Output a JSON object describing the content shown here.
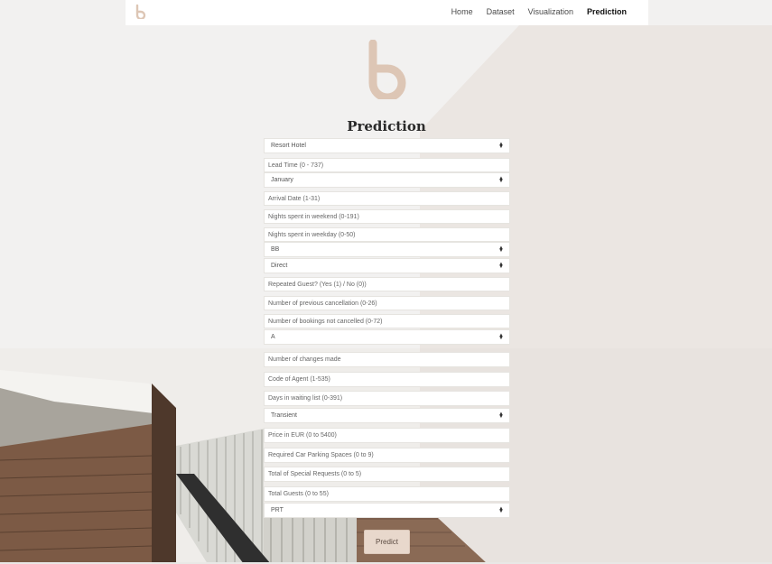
{
  "nav": {
    "brand_letter": "b",
    "links": [
      "Home",
      "Dataset",
      "Visualization",
      "Prediction"
    ],
    "active": "Prediction"
  },
  "page": {
    "title": "Prediction",
    "button_label": "Predict"
  },
  "form": {
    "hotel": "Resort Hotel",
    "lead_time": "Lead Time (0 - 737)",
    "arrival_month": "January",
    "arrival_date": "Arrival Date (1-31)",
    "weekend_nights": "Nights spent in weekend (0-191)",
    "weekday_nights": "Nights spent in weekday (0-50)",
    "meal": "BB",
    "distribution_channel": "Direct",
    "repeated_guest": "Repeated Guest? (Yes (1) / No (0))",
    "prev_cancellation": "Number of previous cancellation (0-26)",
    "bookings_not_cancelled": "Number of bookings not cancelled (0-72)",
    "room_type": "A",
    "changes_made": "Number of changes made",
    "agent_code": "Code of Agent (1-535)",
    "waiting_days": "Days in waiting list (0-391)",
    "customer_type": "Transient",
    "price": "Price in EUR (0 to 5400)",
    "parking": "Required Car Parking Spaces (0 to 9)",
    "special_requests": "Total of Special Requests (0 to 5)",
    "total_guests": "Total Guests (0 to 55)",
    "country": "PRT"
  },
  "colors": {
    "accent": "#ddc6b5",
    "button_bg": "#e8d8cc",
    "page_bg": "#f2f1ef"
  }
}
